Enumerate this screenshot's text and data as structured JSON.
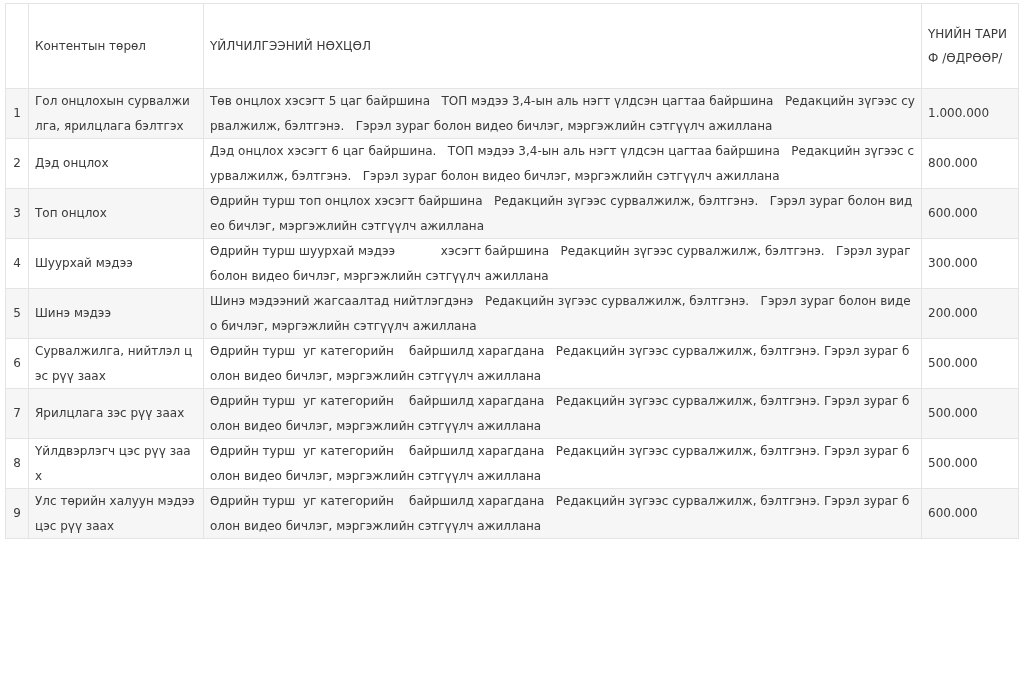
{
  "table": {
    "columns": [
      "",
      "Контентын төрөл",
      "ҮЙЛЧИЛГЭЭНИЙ НӨХЦӨЛ",
      "ҮНИЙН ТАРИФ /ӨДРӨӨР/"
    ],
    "rows": [
      [
        "1",
        "Гол онцлохын сурвалжилга, ярилцлага бэлтгэх",
        "Төв онцлох хэсэгт 5 цаг байршина   ТОП мэдээ 3,4-ын аль нэгт үлдсэн цагтаа байршина   Редакцийн зүгээс сурвалжилж, бэлтгэнэ.   Гэрэл зураг болон видео бичлэг, мэргэжлийн сэтгүүлч ажиллана",
        "1.000.000"
      ],
      [
        "2",
        "Дэд онцлох",
        "Дэд онцлох хэсэгт 6 цаг байршина.   ТОП мэдээ 3,4-ын аль нэгт үлдсэн цагтаа байршина   Редакцийн зүгээс сурвалжилж, бэлтгэнэ.   Гэрэл зураг болон видео бичлэг, мэргэжлийн сэтгүүлч ажиллана",
        "800.000"
      ],
      [
        "3",
        "Топ онцлох",
        "Өдрийн турш топ онцлох хэсэгт байршина   Редакцийн зүгээс сурвалжилж, бэлтгэнэ.   Гэрэл зураг болон видео бичлэг, мэргэжлийн сэтгүүлч ажиллана",
        "600.000"
      ],
      [
        "4",
        "Шуурхай мэдээ",
        "Өдрийн турш шуурхай мэдээ            хэсэгт байршина   Редакцийн зүгээс сурвалжилж, бэлтгэнэ.   Гэрэл зураг болон видео бичлэг, мэргэжлийн сэтгүүлч ажиллана",
        "300.000"
      ],
      [
        "5",
        "Шинэ мэдээ",
        "Шинэ мэдээний жагсаалтад нийтлэгдэнэ   Редакцийн зүгээс сурвалжилж, бэлтгэнэ.   Гэрэл зураг болон видео бичлэг, мэргэжлийн сэтгүүлч ажиллана",
        "200.000"
      ],
      [
        "6",
        "Сурвалжилга, нийтлэл цэс рүү заах",
        "Өдрийн турш  уг категорийн    байршилд харагдана   Редакцийн зүгээс сурвалжилж, бэлтгэнэ. Гэрэл зураг болон видео бичлэг, мэргэжлийн сэтгүүлч ажиллана",
        "500.000"
      ],
      [
        "7",
        "Ярилцлага зэс рүү заах",
        "Өдрийн турш  уг категорийн    байршилд харагдана   Редакцийн зүгээс сурвалжилж, бэлтгэнэ. Гэрэл зураг болон видео бичлэг, мэргэжлийн сэтгүүлч ажиллана",
        "500.000"
      ],
      [
        "8",
        "Үйлдвэрлэгч цэс рүү заах",
        "Өдрийн турш  уг категорийн    байршилд харагдана   Редакцийн зүгээс сурвалжилж, бэлтгэнэ. Гэрэл зураг болон видео бичлэг, мэргэжлийн сэтгүүлч ажиллана",
        "500.000"
      ],
      [
        "9",
        "Улс төрийн халуун мэдээ цэс рүү заах",
        "Өдрийн турш  уг категорийн    байршилд харагдана   Редакцийн зүгээс сурвалжилж, бэлтгэнэ. Гэрэл зураг болон видео бичлэг, мэргэжлийн сэтгүүлч ажиллана",
        "600.000"
      ]
    ]
  }
}
